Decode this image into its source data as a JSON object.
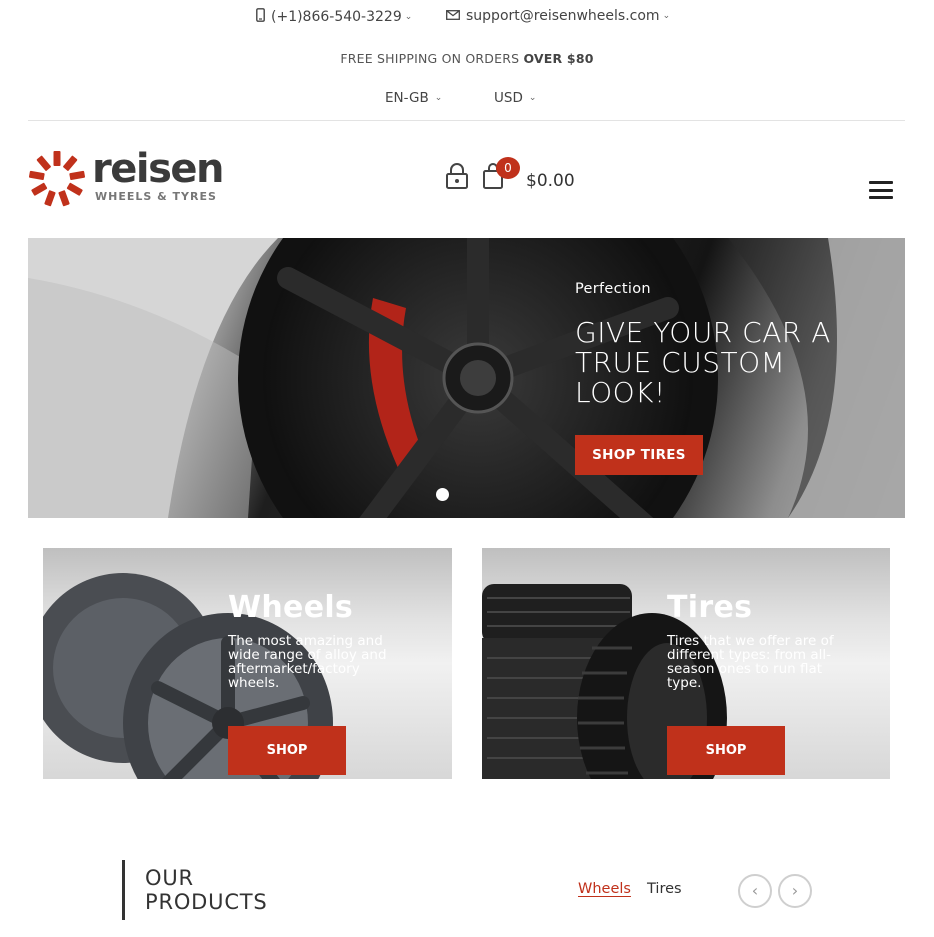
{
  "topbar": {
    "phone": "(+1)866-540-3229",
    "email": "support@reisenwheels.com",
    "shipping_prefix": "FREE SHIPPING ON ORDERS",
    "shipping_bold": "OVER $80",
    "language": "EN-GB",
    "currency": "USD"
  },
  "header": {
    "logo_word": "reisen",
    "logo_tagline": "WHEELS & TYRES",
    "cart_count": "0",
    "cart_total": "$0.00"
  },
  "hero": {
    "kicker": "Perfection",
    "title": "GIVE YOUR CAR A TRUE CUSTOM LOOK!",
    "button": "SHOP TIRES",
    "slide_count": 1
  },
  "promos": [
    {
      "title": "Wheels",
      "text": "The most amazing and wide range of alloy and aftermarket/factory wheels.",
      "button": "SHOP"
    },
    {
      "title": "Tires",
      "text": "Tires that we offer are of different types: from all-season ones to run flat type.",
      "button": "SHOP"
    }
  ],
  "products": {
    "title": "OUR PRODUCTS",
    "tabs": [
      "Wheels",
      "Tires"
    ],
    "active_tab": "Wheels",
    "prev": "‹",
    "next": "›"
  },
  "colors": {
    "accent": "#c0311b",
    "text": "#333333"
  },
  "icons": {
    "phone": "phone-icon",
    "email": "envelope-icon",
    "account": "lock-icon",
    "cart": "shopping-bag-icon",
    "menu": "hamburger-menu-icon"
  }
}
